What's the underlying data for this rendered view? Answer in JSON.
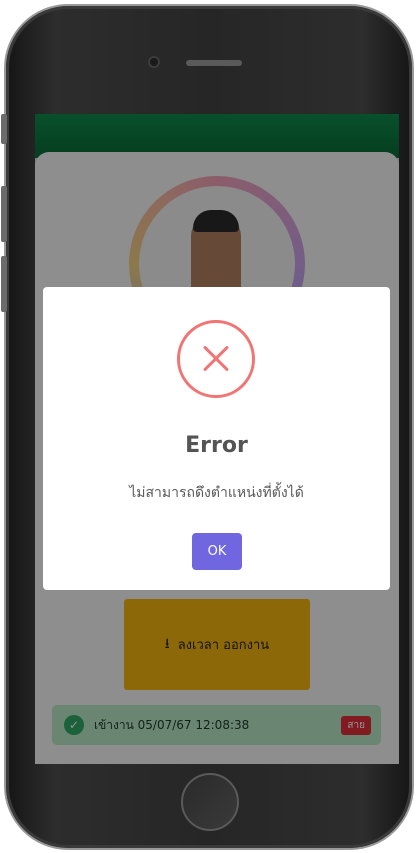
{
  "screen": {
    "clock_out_button": {
      "label": "ลงเวลา ออกงาน",
      "icon": "download-icon"
    },
    "status_bar": {
      "text": "เข้างาน 05/07/67 12:08:38",
      "badge": "สาย",
      "icon": "check-circle-icon"
    }
  },
  "modal": {
    "icon": "error-x-icon",
    "title": "Error",
    "message": "ไม่สามารถดึงตำแหน่งที่ตั้งได้",
    "ok_label": "OK"
  },
  "colors": {
    "appbar": "#0f8a4a",
    "clock_out": "#f2b40e",
    "status_bg": "#b9e6c7",
    "late_badge": "#e0303a",
    "error_accent": "#f27474",
    "ok_button": "#7066e0"
  }
}
